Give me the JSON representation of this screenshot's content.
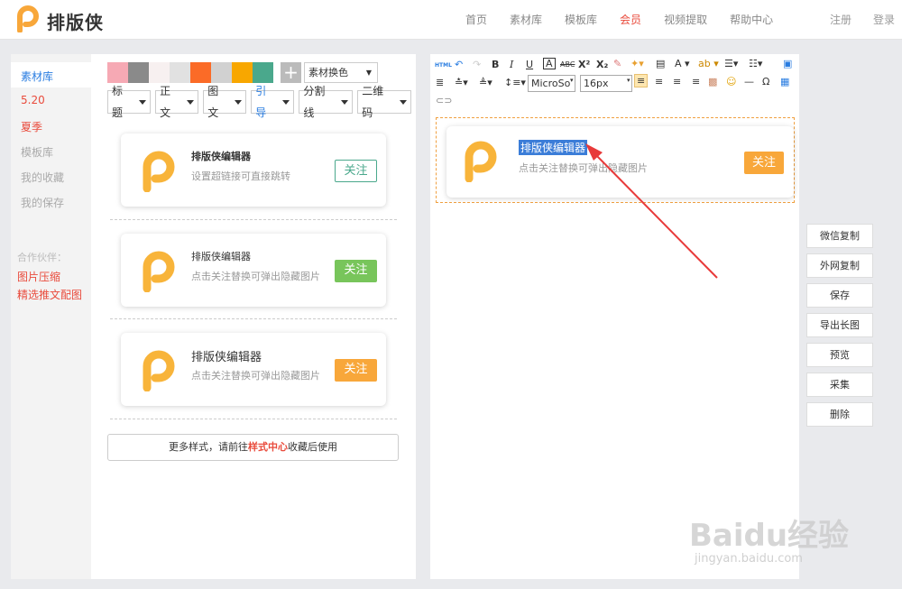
{
  "header": {
    "logo_text": "排版侠",
    "nav": [
      "首页",
      "素材库",
      "模板库",
      "会员",
      "视频提取",
      "帮助中心"
    ],
    "active_nav": "会员",
    "auth": [
      "注册",
      "登录"
    ]
  },
  "sidebar": {
    "items": [
      {
        "label": "素材库",
        "color": "#2a7de1"
      },
      {
        "label": "5.20",
        "color": "#e94b3c"
      },
      {
        "label": "夏季",
        "color": "#e94b3c"
      },
      {
        "label": "模板库",
        "color": "#aaaaaa"
      },
      {
        "label": "我的收藏",
        "color": "#aaaaaa"
      },
      {
        "label": "我的保存",
        "color": "#aaaaaa"
      }
    ],
    "partner_label": "合作伙伴：",
    "partners": [
      "图片压缩",
      "精选推文配图"
    ]
  },
  "palette": {
    "colors": [
      "#f6a9b4",
      "#8a8a8a",
      "#f7f0f0",
      "#e1e1e1",
      "#fb6b27",
      "#d1d1d1",
      "#f8a700",
      "#4aa88c"
    ],
    "select_label": "素材换色"
  },
  "tabs": [
    {
      "label": "标题"
    },
    {
      "label": "正文"
    },
    {
      "label": "图文"
    },
    {
      "label": "引导"
    },
    {
      "label": "分割线"
    },
    {
      "label": "二维码"
    }
  ],
  "active_tab": "引导",
  "cards": [
    {
      "title": "排版侠编辑器",
      "subtitle": "设置超链接可直接跳转",
      "button": "关注",
      "button_style": "outline",
      "button_color": "#4aa88c"
    },
    {
      "title": "排版侠编辑器",
      "subtitle": "点击关注替换可弹出隐藏图片",
      "button": "关注",
      "button_style": "filled",
      "button_color": "#78c55b"
    },
    {
      "title": "排版侠编辑器",
      "subtitle": "点击关注替换可弹出隐藏图片",
      "button": "关注",
      "button_style": "filled",
      "button_color": "#f8a73a"
    }
  ],
  "more": {
    "prefix": "更多样式，请前往",
    "highlight": "样式中心",
    "suffix": "收藏后使用"
  },
  "editor": {
    "font_family": "MicroSo",
    "font_size": "16px",
    "card": {
      "title": "排版侠编辑器",
      "subtitle": "点击关注替换可弹出隐藏图片",
      "button": "关注"
    }
  },
  "actions": [
    "微信复制",
    "外网复制",
    "保存",
    "导出长图",
    "预览",
    "采集",
    "删除"
  ],
  "watermark": {
    "brand": "Baidu经验",
    "url": "jingyan.baidu.com"
  }
}
